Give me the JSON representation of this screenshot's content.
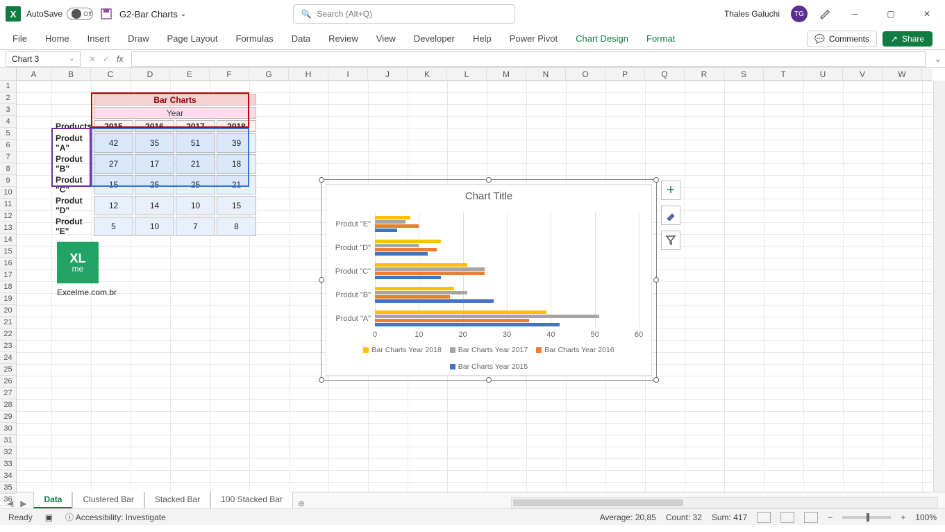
{
  "title_bar": {
    "autosave_label": "AutoSave",
    "autosave_state": "Off",
    "file_name": "G2-Bar Charts",
    "search_placeholder": "Search (Alt+Q)",
    "user_name": "Thales Galuchi",
    "user_initials": "TG"
  },
  "ribbon": {
    "tabs": [
      "File",
      "Home",
      "Insert",
      "Draw",
      "Page Layout",
      "Formulas",
      "Data",
      "Review",
      "View",
      "Developer",
      "Help",
      "Power Pivot",
      "Chart Design",
      "Format"
    ],
    "comments": "Comments",
    "share": "Share"
  },
  "formula_bar": {
    "name_box": "Chart 3",
    "formula": ""
  },
  "columns": [
    "A",
    "B",
    "C",
    "D",
    "E",
    "F",
    "G",
    "H",
    "I",
    "J",
    "K",
    "L",
    "M",
    "N",
    "O",
    "P",
    "Q",
    "R",
    "S",
    "T",
    "U",
    "V",
    "W"
  ],
  "rows": 36,
  "table": {
    "title": "Bar Charts",
    "subtitle": "Year",
    "row_header": "Products",
    "years": [
      "2015",
      "2016",
      "2017",
      "2018"
    ],
    "products": [
      "Produt \"A\"",
      "Produt \"B\"",
      "Produt \"C\"",
      "Produt \"D\"",
      "Produt \"E\""
    ],
    "values": [
      [
        42,
        35,
        51,
        39
      ],
      [
        27,
        17,
        21,
        18
      ],
      [
        15,
        25,
        25,
        21
      ],
      [
        12,
        14,
        10,
        15
      ],
      [
        5,
        10,
        7,
        8
      ]
    ]
  },
  "logo_caption": "Excelme.com.br",
  "chart_data": {
    "type": "bar",
    "title": "Chart Title",
    "categories": [
      "Produt \"E\"",
      "Produt \"D\"",
      "Produt \"C\"",
      "Produt \"B\"",
      "Produt \"A\""
    ],
    "series": [
      {
        "name": "Bar Charts Year 2018",
        "color": "#ffc000",
        "values": [
          8,
          15,
          21,
          18,
          39
        ]
      },
      {
        "name": "Bar Charts Year 2017",
        "color": "#a6a6a6",
        "values": [
          7,
          10,
          25,
          21,
          51
        ]
      },
      {
        "name": "Bar Charts Year 2016",
        "color": "#ed7d31",
        "values": [
          10,
          14,
          25,
          17,
          35
        ]
      },
      {
        "name": "Bar Charts Year 2015",
        "color": "#4472c4",
        "values": [
          5,
          12,
          15,
          27,
          42
        ]
      }
    ],
    "xlabel": "",
    "ylabel": "",
    "xlim": [
      0,
      60
    ],
    "xticks": [
      0,
      10,
      20,
      30,
      40,
      50,
      60
    ]
  },
  "sheet_tabs": [
    "Data",
    "Clustered Bar",
    "Stacked Bar",
    "100 Stacked Bar"
  ],
  "active_sheet": "Data",
  "status": {
    "ready": "Ready",
    "accessibility": "Accessibility: Investigate",
    "average_label": "Average:",
    "average": "20,85",
    "count_label": "Count:",
    "count": "32",
    "sum_label": "Sum:",
    "sum": "417",
    "zoom": "100%"
  }
}
